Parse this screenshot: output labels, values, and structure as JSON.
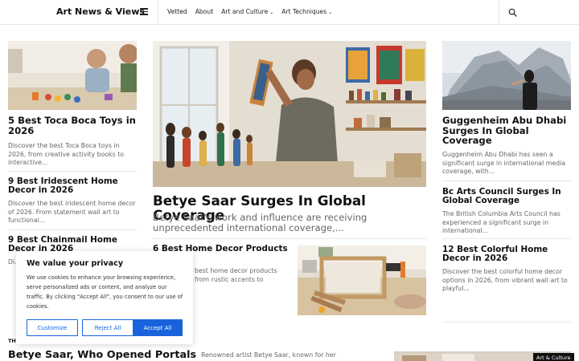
{
  "header": {
    "brand": "Art News & Views",
    "nav": [
      {
        "label": "Vetted",
        "has_dropdown": false
      },
      {
        "label": "About",
        "has_dropdown": false
      },
      {
        "label": "Art and Culture",
        "has_dropdown": true
      },
      {
        "label": "Art Techniques",
        "has_dropdown": true
      }
    ],
    "icons": {
      "menu": "hamburger-icon",
      "search": "search-icon",
      "dropdown": "chevron-down-icon"
    }
  },
  "left_column": {
    "articles": [
      {
        "title": "5 Best Toca Boca Toys in 2026",
        "desc": "Discover the best Toca Boca toys in 2026, from creative activity books to interactive..."
      },
      {
        "title": "9 Best Iridescent Home Decor in 2026",
        "desc": "Discover the best iridescent home decor of 2026. From statement wall art to functional..."
      },
      {
        "title": "9 Best Chainmail Home Decor in 2026",
        "desc": "Di..."
      }
    ],
    "section_label": "TH"
  },
  "center_column": {
    "feature": {
      "title": "Betye Saar Surges In Global Coverage",
      "desc": "Betye Saar's work and influence are receiving unprecedented international coverage,..."
    },
    "small_article": {
      "title": "6 Best Home Decor Products",
      "desc": "best home decor products from rustic accents to"
    }
  },
  "right_column": {
    "articles": [
      {
        "title": "Guggenheim Abu Dhabi Surges In Global Coverage",
        "desc": "Guggenheim Abu Dhabi has seen a significant surge in international media coverage, with..."
      },
      {
        "title": "Bc Arts Council Surges In Global Coverage",
        "desc": "The British Columbia Arts Council has experienced a significant surge in international..."
      },
      {
        "title": "12 Best Colorful Home Decor in 2026",
        "desc": "Discover the best colorful home decor options in 2026, from vibrant wall art to playful..."
      }
    ]
  },
  "bottom": {
    "headline": "Betye Saar, Who Opened Portals",
    "snippet": "Renowned artist Betye Saar, known for her",
    "badge": "Art & Culture"
  },
  "cookie": {
    "title": "We value your privacy",
    "text": "We use cookies to enhance your browsing experience, serve personalized ads or content, and analyze our traffic. By clicking \"Accept All\", you consent to our use of cookies.",
    "customize": "Customize",
    "reject": "Reject All",
    "accept": "Accept All"
  },
  "colors": {
    "accent": "#1863dc",
    "text": "#111111",
    "muted": "#666666"
  }
}
